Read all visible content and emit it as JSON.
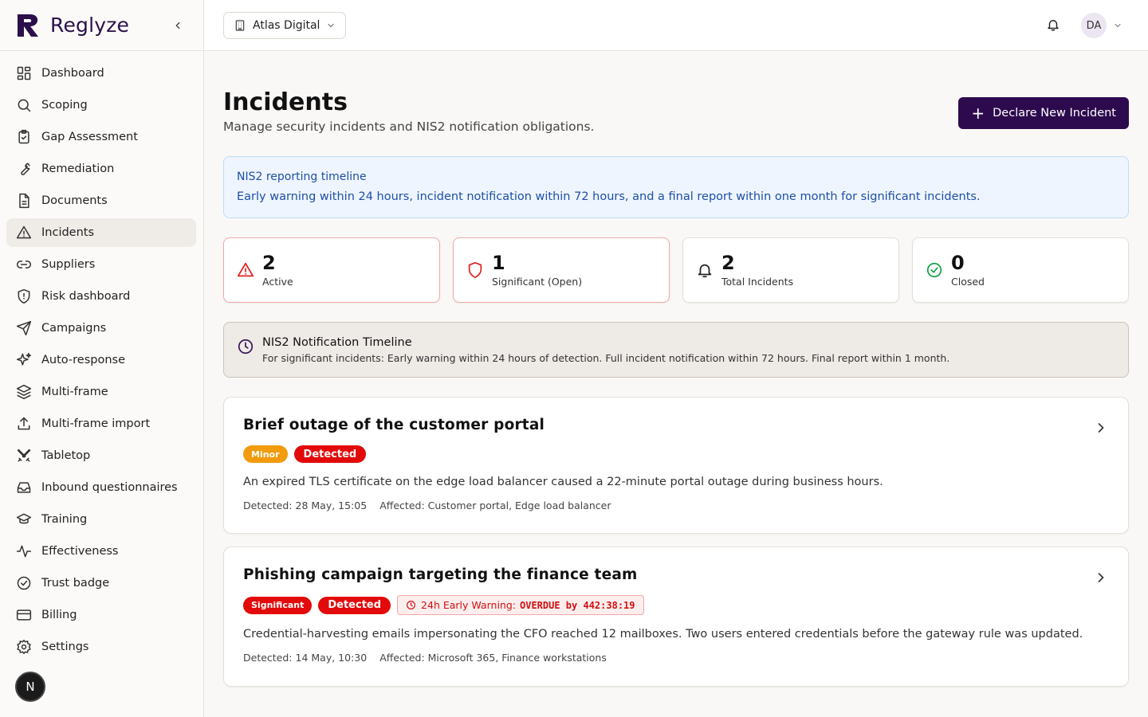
{
  "brand": {
    "name": "Reglyze"
  },
  "sidebar": {
    "items": [
      {
        "label": "Dashboard",
        "icon": "dashboard-icon"
      },
      {
        "label": "Scoping",
        "icon": "search-icon"
      },
      {
        "label": "Gap Assessment",
        "icon": "clipboard-check-icon"
      },
      {
        "label": "Remediation",
        "icon": "wrench-icon"
      },
      {
        "label": "Documents",
        "icon": "document-icon"
      },
      {
        "label": "Incidents",
        "icon": "alert-triangle-icon",
        "active": true
      },
      {
        "label": "Suppliers",
        "icon": "link-icon"
      },
      {
        "label": "Risk dashboard",
        "icon": "shield-icon"
      },
      {
        "label": "Campaigns",
        "icon": "send-icon"
      },
      {
        "label": "Auto-response",
        "icon": "sparkles-icon"
      },
      {
        "label": "Multi-frame",
        "icon": "layers-icon"
      },
      {
        "label": "Multi-frame import",
        "icon": "upload-icon"
      },
      {
        "label": "Tabletop",
        "icon": "swords-icon"
      },
      {
        "label": "Inbound questionnaires",
        "icon": "inbox-icon"
      },
      {
        "label": "Training",
        "icon": "graduation-cap-icon"
      },
      {
        "label": "Effectiveness",
        "icon": "activity-icon"
      },
      {
        "label": "Trust badge",
        "icon": "badge-check-icon"
      },
      {
        "label": "Billing",
        "icon": "credit-card-icon"
      },
      {
        "label": "Settings",
        "icon": "gear-icon"
      }
    ],
    "bottom_avatar": "N"
  },
  "topbar": {
    "org": "Atlas Digital",
    "user_initials": "DA"
  },
  "page": {
    "title": "Incidents",
    "subtitle": "Manage security incidents and NIS2 notification obligations.",
    "declare_label": "Declare New Incident"
  },
  "banner": {
    "title": "NIS2 reporting timeline",
    "text": "Early warning within 24 hours, incident notification within 72 hours, and a final report within one month for significant incidents."
  },
  "stats": [
    {
      "value": "2",
      "label": "Active",
      "icon": "alert-triangle-icon",
      "color": "#e02424"
    },
    {
      "value": "1",
      "label": "Significant (Open)",
      "icon": "shield-icon",
      "color": "#e02424"
    },
    {
      "value": "2",
      "label": "Total Incidents",
      "icon": "bell-icon",
      "color": "#222222"
    },
    {
      "value": "0",
      "label": "Closed",
      "icon": "check-circle-icon",
      "color": "#16a34a"
    }
  ],
  "timeline": {
    "title": "NIS2 Notification Timeline",
    "text": "For significant incidents: Early warning within 24 hours of detection. Full incident notification within 72 hours. Final report within 1 month."
  },
  "incidents": [
    {
      "title": "Brief outage of the customer portal",
      "severity": "Minor",
      "status": "Detected",
      "description": "An expired TLS certificate on the edge load balancer caused a 22-minute portal outage during business hours.",
      "detected": "Detected: 28 May, 15:05",
      "affected": "Affected: Customer portal, Edge load balancer"
    },
    {
      "title": "Phishing campaign targeting the finance team",
      "severity": "Significant",
      "status": "Detected",
      "warning_label": "24h Early Warning:",
      "warning_value": "OVERDUE by 442:38:19",
      "description": "Credential-harvesting emails impersonating the CFO reached 12 mailboxes. Two users entered credentials before the gateway rule was updated.",
      "detected": "Detected: 14 May, 10:30",
      "affected": "Affected: Microsoft 365, Finance workstations"
    }
  ],
  "colors": {
    "primary": "#2d0a4e",
    "danger": "#e20a0a",
    "warning": "#f29b0c",
    "info_bg": "#eef5fe",
    "info_text": "#1d4fa8"
  }
}
